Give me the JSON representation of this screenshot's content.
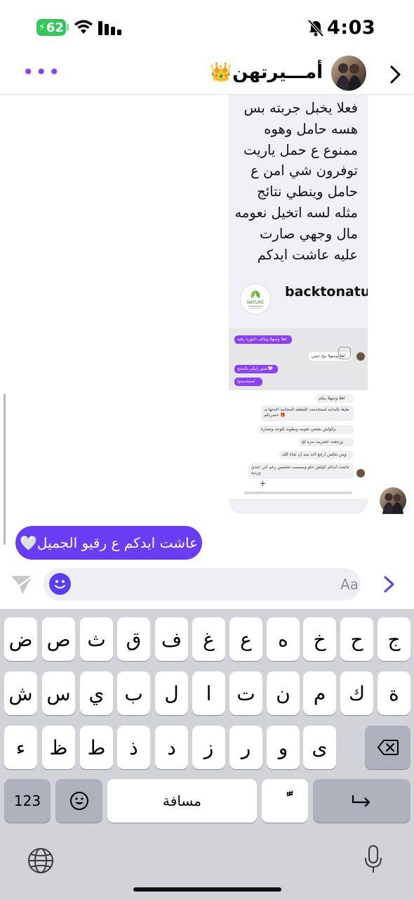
{
  "status_bar": {
    "battery": "62",
    "time": "4:03"
  },
  "header": {
    "contact_name": "أمـــيرتهن👑",
    "more_icon": "more-dots-icon",
    "back_icon": "chevron-right-icon"
  },
  "shared_post": {
    "text": "فعلا يخبل جربته بس هسه حامل وهوه ممنوع ع حمل ياريت توفرون شي امن ع حامل وينطي نتائج مثله لسه اتخيل نعومه مال وجهي صارت عليه عاشت ايدكم",
    "source_name": "backtonature.br",
    "logo_text": "NATURE",
    "screenshot_messages": [
      "اهلا وسهلا وياكم دكتوره رفيه",
      "اهلا وسهلا بيج عيني",
      "شنو رايكم بالمنتج🤍",
      "استخدمتوا",
      "اهلا وسهلا بيكم",
      "طبعا بالبدايه لستخدمت القطعه المجانيه اخذتها مـ🎁 حضرتكم",
      "وكولش نفتتني نعومه وبطوبه للوجه ونضاره",
      "ورجعت اشتريت مره لخ",
      "ومن تخلص ارجع اخذ منه ان شاء الله",
      "عاشت ايدكم كولش حلو وميسبب تحسس رغم اني عندي وردية"
    ]
  },
  "my_message": "عاشت ايدكم ع رقيو الجميل🤍",
  "composer": {
    "placeholder": "Aa"
  },
  "keyboard": {
    "row1": [
      "ض",
      "ص",
      "ث",
      "ق",
      "ف",
      "غ",
      "ع",
      "ه",
      "خ",
      "ح",
      "ج"
    ],
    "row2": [
      "ش",
      "س",
      "ي",
      "ب",
      "ل",
      "ا",
      "ت",
      "ن",
      "م",
      "ك",
      "ة"
    ],
    "row3": [
      "ء",
      "ظ",
      "ط",
      "ذ",
      "د",
      "ز",
      "ر",
      "و",
      "ى"
    ],
    "numbers_label": "123",
    "space_label": "مسافة",
    "diacritic_label": "ًّ"
  },
  "colors": {
    "accent": "#6a3df5",
    "purple": "#8a3ffc",
    "battery": "#34c759"
  }
}
